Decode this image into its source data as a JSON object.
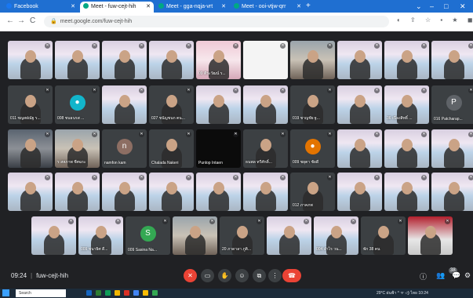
{
  "browser": {
    "tabs": [
      {
        "label": "Facebook",
        "icon_color": "#1877f2",
        "active": false
      },
      {
        "label": "Meet - fuw-cejt-hih",
        "icon_color": "#00a884",
        "active": true
      },
      {
        "label": "Meet - gga-nqja-vrt",
        "icon_color": "#00a884",
        "active": false
      },
      {
        "label": "Meet - ooi-vtjw-qrr",
        "icon_color": "#00a884",
        "active": false
      }
    ],
    "new_tab": "+",
    "url": "meet.google.com/fuw-cejt-hih",
    "window_controls": [
      "⌄",
      "–",
      "□",
      "✕"
    ],
    "nav": {
      "back": "←",
      "forward": "→",
      "reload": "C"
    },
    "toolbar_icons": "◐ ⇪ ☆ ▪ ★ ◼ ⋮"
  },
  "meet": {
    "tiles": [
      {
        "label": "",
        "style": "photo-banner"
      },
      {
        "label": "",
        "style": "photo-banner"
      },
      {
        "label": "",
        "style": "photo-banner"
      },
      {
        "label": "",
        "style": "photo-banner"
      },
      {
        "label": "09 ตีระวัฒน์ ร...",
        "style": "photo-pink"
      },
      {
        "label": "",
        "style": "photo-qr"
      },
      {
        "label": "",
        "style": "photo-room"
      },
      {
        "label": "",
        "style": "photo-banner"
      },
      {
        "label": "",
        "style": "photo-banner"
      },
      {
        "label": "",
        "style": "photo-banner"
      },
      {
        "label": "011 ชญสฝณัฐ ร...",
        "style": "plain"
      },
      {
        "label": "008 ชนธนรส ...",
        "style": "plain",
        "avatar": "●",
        "avatar_color": "#12b5cb"
      },
      {
        "label": "",
        "style": "photo-banner"
      },
      {
        "label": "027 ชนัญชนก ตน...",
        "style": "plain"
      },
      {
        "label": "",
        "style": "photo-banner"
      },
      {
        "label": "",
        "style": "photo-banner"
      },
      {
        "label": "019 ชาญชัย ฐ...",
        "style": "plain"
      },
      {
        "label": "",
        "style": "photo-banner"
      },
      {
        "label": "36 เนื่องสิทธิ์ ...",
        "style": "photo-banner"
      },
      {
        "label": "016 Patcharap...",
        "style": "plain",
        "avatar": "P",
        "avatar_color": "#5f6368"
      },
      {
        "label": "",
        "style": "photo-dark"
      },
      {
        "label": "ร สหภาพ ชีศฉระ",
        "style": "photo-room"
      },
      {
        "label": "namfon kam",
        "style": "plain",
        "avatar": "n",
        "avatar_color": "#8d6e63"
      },
      {
        "label": "Chalada Nakeri",
        "style": "plain"
      },
      {
        "label": "Punlop Intaen",
        "style": "photo-black"
      },
      {
        "label": "ธนพล ทวีศักดิ์...",
        "style": "plain"
      },
      {
        "label": "009 ชยุตา ชัยดี",
        "style": "plain",
        "avatar": "●",
        "avatar_color": "#e37400"
      },
      {
        "label": "",
        "style": "photo-banner"
      },
      {
        "label": "",
        "style": "photo-banner"
      },
      {
        "label": "",
        "style": "photo-banner"
      },
      {
        "label": "",
        "style": "photo-banner"
      },
      {
        "label": "",
        "style": "photo-banner"
      },
      {
        "label": "",
        "style": "photo-banner"
      },
      {
        "label": "",
        "style": "photo-banner"
      },
      {
        "label": "",
        "style": "photo-banner"
      },
      {
        "label": "",
        "style": "photo-banner"
      },
      {
        "label": "012 ภาคภพ",
        "style": "plain"
      },
      {
        "label": "",
        "style": "photo-banner"
      },
      {
        "label": "",
        "style": "photo-banner"
      },
      {
        "label": "",
        "style": "photo-banner"
      },
      {
        "label": "",
        "style": "photo-banner"
      },
      {
        "label": "009 ชนาธิศ ดี...",
        "style": "photo-banner"
      },
      {
        "label": "009 Sasina Na...",
        "style": "plain",
        "avatar": "S",
        "avatar_color": "#34a853"
      },
      {
        "label": "",
        "style": "photo-room"
      },
      {
        "label": "20 ภาดาลา ภูติ...",
        "style": "plain"
      },
      {
        "label": "",
        "style": "photo-banner"
      },
      {
        "label": "004 ลำไร วน...",
        "style": "photo-banner"
      },
      {
        "label": "พัก 38 คน",
        "style": "plain"
      },
      {
        "label": "",
        "style": "photo-red"
      }
    ],
    "meeting_time": "09:24",
    "meeting_code": "fuw-cejt-hih",
    "controls": [
      "mic-off",
      "camera",
      "hand",
      "emoji",
      "present",
      "more",
      "end-call"
    ],
    "control_glyphs": [
      "✕",
      "▭",
      "✋",
      "☺",
      "⧉",
      "⋮",
      "☎"
    ],
    "right_controls": [
      "ⓘ",
      "👥",
      "💬",
      "⚙"
    ],
    "participant_count": "38"
  },
  "taskbar": {
    "search_placeholder": "Search",
    "apps": [
      "#1565c0",
      "#2e7d32",
      "#0f9d58",
      "#f2b600",
      "#d93025",
      "#4285f4",
      "#fbbc04",
      "#34a853"
    ],
    "tray": "29°C ฝนฟ้า ^ ᯤ ◁) ไทย 10:24"
  }
}
